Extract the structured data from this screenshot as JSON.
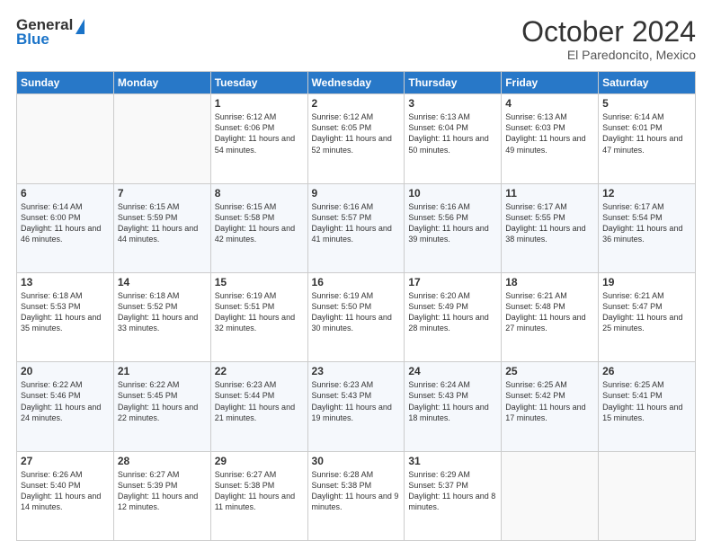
{
  "header": {
    "logo_general": "General",
    "logo_blue": "Blue",
    "month_title": "October 2024",
    "subtitle": "El Paredoncito, Mexico"
  },
  "weekdays": [
    "Sunday",
    "Monday",
    "Tuesday",
    "Wednesday",
    "Thursday",
    "Friday",
    "Saturday"
  ],
  "weeks": [
    [
      {
        "day": "",
        "text": ""
      },
      {
        "day": "",
        "text": ""
      },
      {
        "day": "1",
        "text": "Sunrise: 6:12 AM\nSunset: 6:06 PM\nDaylight: 11 hours and 54 minutes."
      },
      {
        "day": "2",
        "text": "Sunrise: 6:12 AM\nSunset: 6:05 PM\nDaylight: 11 hours and 52 minutes."
      },
      {
        "day": "3",
        "text": "Sunrise: 6:13 AM\nSunset: 6:04 PM\nDaylight: 11 hours and 50 minutes."
      },
      {
        "day": "4",
        "text": "Sunrise: 6:13 AM\nSunset: 6:03 PM\nDaylight: 11 hours and 49 minutes."
      },
      {
        "day": "5",
        "text": "Sunrise: 6:14 AM\nSunset: 6:01 PM\nDaylight: 11 hours and 47 minutes."
      }
    ],
    [
      {
        "day": "6",
        "text": "Sunrise: 6:14 AM\nSunset: 6:00 PM\nDaylight: 11 hours and 46 minutes."
      },
      {
        "day": "7",
        "text": "Sunrise: 6:15 AM\nSunset: 5:59 PM\nDaylight: 11 hours and 44 minutes."
      },
      {
        "day": "8",
        "text": "Sunrise: 6:15 AM\nSunset: 5:58 PM\nDaylight: 11 hours and 42 minutes."
      },
      {
        "day": "9",
        "text": "Sunrise: 6:16 AM\nSunset: 5:57 PM\nDaylight: 11 hours and 41 minutes."
      },
      {
        "day": "10",
        "text": "Sunrise: 6:16 AM\nSunset: 5:56 PM\nDaylight: 11 hours and 39 minutes."
      },
      {
        "day": "11",
        "text": "Sunrise: 6:17 AM\nSunset: 5:55 PM\nDaylight: 11 hours and 38 minutes."
      },
      {
        "day": "12",
        "text": "Sunrise: 6:17 AM\nSunset: 5:54 PM\nDaylight: 11 hours and 36 minutes."
      }
    ],
    [
      {
        "day": "13",
        "text": "Sunrise: 6:18 AM\nSunset: 5:53 PM\nDaylight: 11 hours and 35 minutes."
      },
      {
        "day": "14",
        "text": "Sunrise: 6:18 AM\nSunset: 5:52 PM\nDaylight: 11 hours and 33 minutes."
      },
      {
        "day": "15",
        "text": "Sunrise: 6:19 AM\nSunset: 5:51 PM\nDaylight: 11 hours and 32 minutes."
      },
      {
        "day": "16",
        "text": "Sunrise: 6:19 AM\nSunset: 5:50 PM\nDaylight: 11 hours and 30 minutes."
      },
      {
        "day": "17",
        "text": "Sunrise: 6:20 AM\nSunset: 5:49 PM\nDaylight: 11 hours and 28 minutes."
      },
      {
        "day": "18",
        "text": "Sunrise: 6:21 AM\nSunset: 5:48 PM\nDaylight: 11 hours and 27 minutes."
      },
      {
        "day": "19",
        "text": "Sunrise: 6:21 AM\nSunset: 5:47 PM\nDaylight: 11 hours and 25 minutes."
      }
    ],
    [
      {
        "day": "20",
        "text": "Sunrise: 6:22 AM\nSunset: 5:46 PM\nDaylight: 11 hours and 24 minutes."
      },
      {
        "day": "21",
        "text": "Sunrise: 6:22 AM\nSunset: 5:45 PM\nDaylight: 11 hours and 22 minutes."
      },
      {
        "day": "22",
        "text": "Sunrise: 6:23 AM\nSunset: 5:44 PM\nDaylight: 11 hours and 21 minutes."
      },
      {
        "day": "23",
        "text": "Sunrise: 6:23 AM\nSunset: 5:43 PM\nDaylight: 11 hours and 19 minutes."
      },
      {
        "day": "24",
        "text": "Sunrise: 6:24 AM\nSunset: 5:43 PM\nDaylight: 11 hours and 18 minutes."
      },
      {
        "day": "25",
        "text": "Sunrise: 6:25 AM\nSunset: 5:42 PM\nDaylight: 11 hours and 17 minutes."
      },
      {
        "day": "26",
        "text": "Sunrise: 6:25 AM\nSunset: 5:41 PM\nDaylight: 11 hours and 15 minutes."
      }
    ],
    [
      {
        "day": "27",
        "text": "Sunrise: 6:26 AM\nSunset: 5:40 PM\nDaylight: 11 hours and 14 minutes."
      },
      {
        "day": "28",
        "text": "Sunrise: 6:27 AM\nSunset: 5:39 PM\nDaylight: 11 hours and 12 minutes."
      },
      {
        "day": "29",
        "text": "Sunrise: 6:27 AM\nSunset: 5:38 PM\nDaylight: 11 hours and 11 minutes."
      },
      {
        "day": "30",
        "text": "Sunrise: 6:28 AM\nSunset: 5:38 PM\nDaylight: 11 hours and 9 minutes."
      },
      {
        "day": "31",
        "text": "Sunrise: 6:29 AM\nSunset: 5:37 PM\nDaylight: 11 hours and 8 minutes."
      },
      {
        "day": "",
        "text": ""
      },
      {
        "day": "",
        "text": ""
      }
    ]
  ]
}
